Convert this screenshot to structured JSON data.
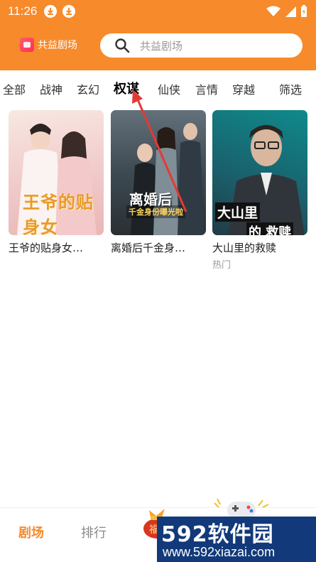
{
  "status_bar": {
    "time": "11:26",
    "icons": [
      "download-icon",
      "download-icon",
      "wifi-icon",
      "signal-icon",
      "battery-icon"
    ]
  },
  "header": {
    "app_name": "共益剧场",
    "search_placeholder": "共益剧场"
  },
  "tabs": [
    {
      "label": "全部",
      "active": false
    },
    {
      "label": "战神",
      "active": false
    },
    {
      "label": "玄幻",
      "active": false
    },
    {
      "label": "权谋",
      "active": true
    },
    {
      "label": "仙侠",
      "active": false
    },
    {
      "label": "言情",
      "active": false
    },
    {
      "label": "穿越",
      "active": false
    }
  ],
  "filter_label": "筛选",
  "cards": [
    {
      "title": "王爷的贴身女…",
      "poster_caption": "王爷的贴身女",
      "tag": ""
    },
    {
      "title": "离婚后千金身…",
      "poster_caption": "离婚后",
      "poster_subcaption": "千金身份曝光啦",
      "tag": ""
    },
    {
      "title": "大山里的救赎",
      "poster_caption": "大山里",
      "poster_subcaption": "的 救赎",
      "tag": "热门"
    }
  ],
  "bottom_nav": {
    "items": [
      {
        "label": "剧场",
        "active": true
      },
      {
        "label": "排行",
        "active": false
      },
      {
        "label": "福",
        "active": false
      }
    ]
  },
  "watermark": {
    "brand": "592软件园",
    "url": "www.592xiazai.com"
  },
  "colors": {
    "accent": "#f78a2b",
    "annotation_arrow": "#e53935"
  }
}
